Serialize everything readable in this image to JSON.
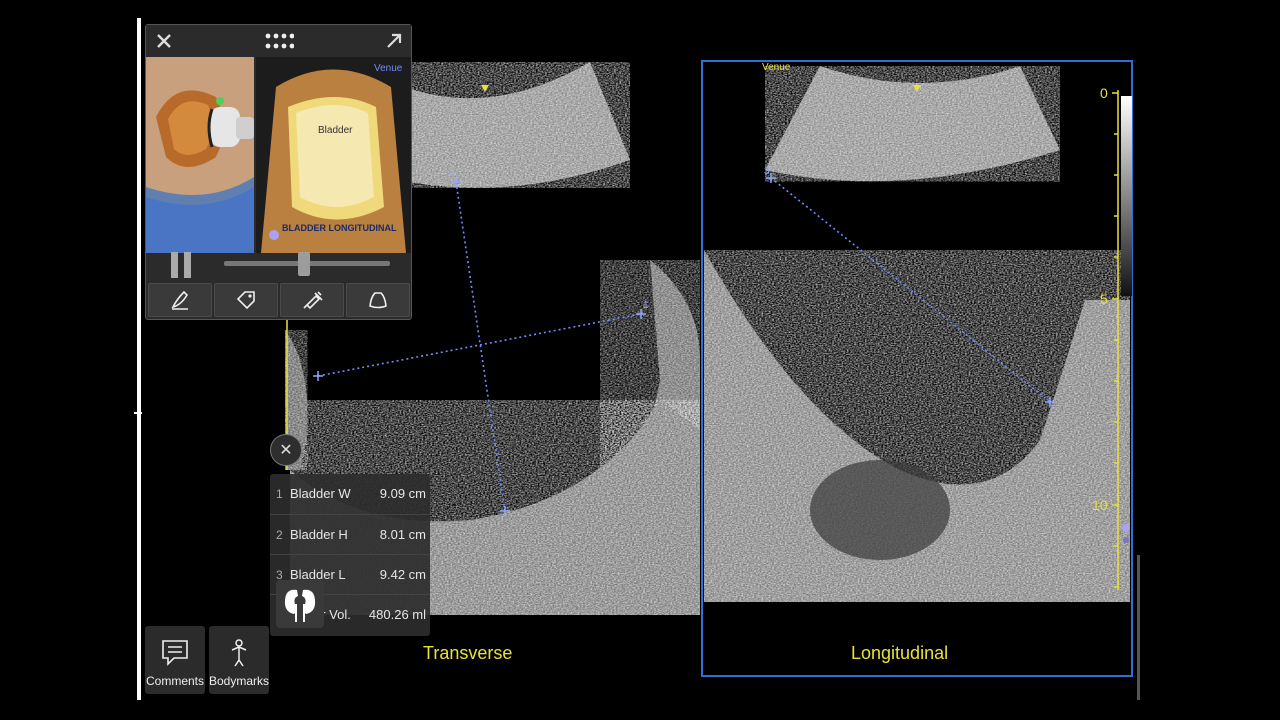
{
  "images": {
    "left_label": "Transverse",
    "right_label": "Longitudinal",
    "right_venue": "Venue"
  },
  "depth_scale": {
    "ticks": [
      "0",
      "5",
      "10"
    ]
  },
  "overlay": {
    "thumb_venue": "Venue",
    "thumb_bladder_label": "Bladder",
    "thumb_caption": "BLADDER LONGITUDINAL",
    "slider_fraction": 0.48
  },
  "caliper_marks": {
    "t1": "1",
    "t2": "2",
    "t3": "3"
  },
  "measurements": [
    {
      "num": "1",
      "name": "Bladder W",
      "value": "9.09 cm"
    },
    {
      "num": "2",
      "name": "Bladder H",
      "value": "8.01 cm"
    },
    {
      "num": "3",
      "name": "Bladder L",
      "value": "9.42 cm"
    },
    {
      "num": "",
      "name": "er Vol.",
      "value": "480.26 ml"
    }
  ],
  "buttons": {
    "comments": "Comments",
    "bodymarks": "Bodymarks"
  },
  "colors": {
    "accent_yellow": "#e8e23a",
    "caliper_blue": "#6f8dff",
    "frame_blue": "#2f6fd6"
  }
}
